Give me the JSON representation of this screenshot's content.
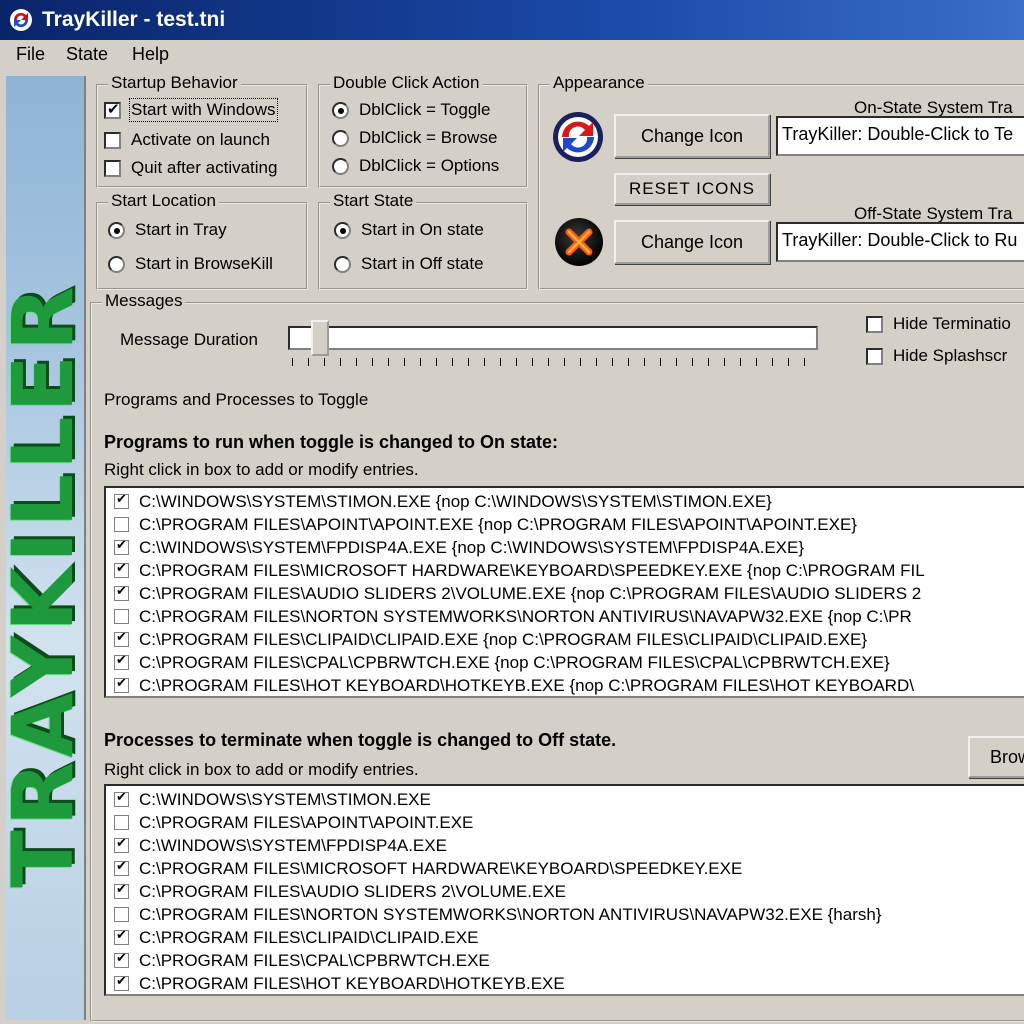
{
  "window": {
    "title": "TrayKiller - test.tni"
  },
  "menu": [
    {
      "label": "File"
    },
    {
      "label": "State"
    },
    {
      "label": "Help"
    }
  ],
  "banner": {
    "text": "TRAYKILLER"
  },
  "startup": {
    "legend": "Startup Behavior",
    "options": [
      {
        "label": "Start with Windows",
        "checked": true
      },
      {
        "label": "Activate on launch",
        "checked": false
      },
      {
        "label": "Quit after activating",
        "checked": false
      }
    ]
  },
  "double_click": {
    "legend": "Double Click Action",
    "options": [
      {
        "label": "DblClick = Toggle",
        "selected": true
      },
      {
        "label": "DblClick = Browse",
        "selected": false
      },
      {
        "label": "DblClick = Options",
        "selected": false
      }
    ]
  },
  "start_location": {
    "legend": "Start Location",
    "options": [
      {
        "label": "Start in Tray",
        "selected": true
      },
      {
        "label": "Start in BrowseKill",
        "selected": false
      }
    ]
  },
  "start_state": {
    "legend": "Start State",
    "options": [
      {
        "label": "Start in On state",
        "selected": true
      },
      {
        "label": "Start in Off state",
        "selected": false
      }
    ]
  },
  "appearance": {
    "legend": "Appearance",
    "on_label": "On-State System Tra",
    "off_label": "Off-State System Tra",
    "change_icon": "Change Icon",
    "reset_icons": "RESET ICONS",
    "on_tooltip": "TrayKiller: Double-Click to Te",
    "off_tooltip": "TrayKiller: Double-Click to Ru"
  },
  "messages": {
    "legend": "Messages",
    "duration_label": "Message Duration",
    "hide_termination": {
      "label": "Hide Terminatio",
      "checked": false
    },
    "hide_splash": {
      "label": "Hide Splashscr",
      "checked": false
    }
  },
  "programs": {
    "legend": "Programs and Processes to Toggle",
    "on_heading": "Programs to run when toggle is changed to On state:",
    "on_hint": "Right click in box to add or modify entries.",
    "on_items": [
      {
        "text": "C:\\WINDOWS\\SYSTEM\\STIMON.EXE {nop C:\\WINDOWS\\SYSTEM\\STIMON.EXE}",
        "checked": true
      },
      {
        "text": "C:\\PROGRAM FILES\\APOINT\\APOINT.EXE {nop C:\\PROGRAM FILES\\APOINT\\APOINT.EXE}",
        "checked": false
      },
      {
        "text": "C:\\WINDOWS\\SYSTEM\\FPDISP4A.EXE {nop C:\\WINDOWS\\SYSTEM\\FPDISP4A.EXE}",
        "checked": true
      },
      {
        "text": "C:\\PROGRAM FILES\\MICROSOFT HARDWARE\\KEYBOARD\\SPEEDKEY.EXE {nop C:\\PROGRAM FIL",
        "checked": true
      },
      {
        "text": "C:\\PROGRAM FILES\\AUDIO SLIDERS 2\\VOLUME.EXE {nop C:\\PROGRAM FILES\\AUDIO SLIDERS 2",
        "checked": true
      },
      {
        "text": "C:\\PROGRAM FILES\\NORTON SYSTEMWORKS\\NORTON ANTIVIRUS\\NAVAPW32.EXE {nop C:\\PR",
        "checked": false
      },
      {
        "text": "C:\\PROGRAM FILES\\CLIPAID\\CLIPAID.EXE {nop C:\\PROGRAM FILES\\CLIPAID\\CLIPAID.EXE}",
        "checked": true
      },
      {
        "text": "C:\\PROGRAM FILES\\CPAL\\CPBRWTCH.EXE {nop C:\\PROGRAM FILES\\CPAL\\CPBRWTCH.EXE}",
        "checked": true
      },
      {
        "text": "C:\\PROGRAM FILES\\HOT KEYBOARD\\HOTKEYB.EXE {nop C:\\PROGRAM FILES\\HOT KEYBOARD\\",
        "checked": true
      }
    ],
    "off_heading": "Processes to terminate when toggle is changed to Off state.",
    "off_hint": "Right click in box to add or modify entries.",
    "browse_button": "Brow",
    "off_items": [
      {
        "text": "C:\\WINDOWS\\SYSTEM\\STIMON.EXE",
        "checked": true
      },
      {
        "text": "C:\\PROGRAM FILES\\APOINT\\APOINT.EXE",
        "checked": false
      },
      {
        "text": "C:\\WINDOWS\\SYSTEM\\FPDISP4A.EXE",
        "checked": true
      },
      {
        "text": "C:\\PROGRAM FILES\\MICROSOFT HARDWARE\\KEYBOARD\\SPEEDKEY.EXE",
        "checked": true
      },
      {
        "text": "C:\\PROGRAM FILES\\AUDIO SLIDERS 2\\VOLUME.EXE",
        "checked": true
      },
      {
        "text": "C:\\PROGRAM FILES\\NORTON SYSTEMWORKS\\NORTON ANTIVIRUS\\NAVAPW32.EXE {harsh}",
        "checked": false
      },
      {
        "text": "C:\\PROGRAM FILES\\CLIPAID\\CLIPAID.EXE",
        "checked": true
      },
      {
        "text": "C:\\PROGRAM FILES\\CPAL\\CPBRWTCH.EXE",
        "checked": true
      },
      {
        "text": "C:\\PROGRAM FILES\\HOT KEYBOARD\\HOTKEYB.EXE",
        "checked": true
      }
    ]
  }
}
